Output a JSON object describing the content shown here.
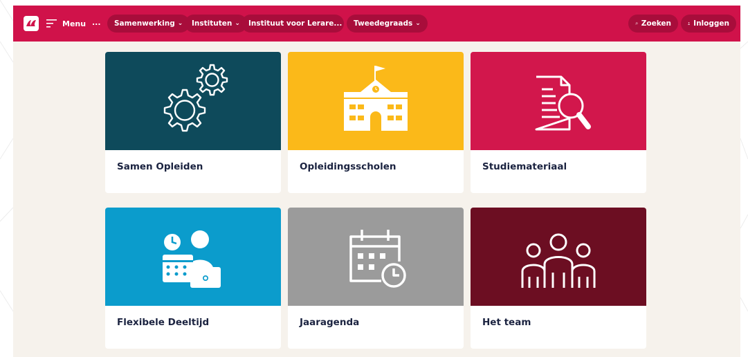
{
  "nav": {
    "menu_label": "Menu",
    "ellipsis": "...",
    "breadcrumbs": [
      {
        "label": "Samenwerking"
      },
      {
        "label": "Instituten"
      },
      {
        "label": "Instituut voor Lerare..."
      },
      {
        "label": "Tweedegraads"
      }
    ],
    "search_label": "Zoeken",
    "login_label": "Inloggen"
  },
  "tiles": [
    {
      "label": "Samen Opleiden",
      "icon": "gears-icon",
      "color": "#0e4a5b"
    },
    {
      "label": "Opleidingsscholen",
      "icon": "school-building-icon",
      "color": "#fbb919"
    },
    {
      "label": "Studiemateriaal",
      "icon": "document-search-icon",
      "color": "#d2174c"
    },
    {
      "label": "Flexibele Deeltijd",
      "icon": "person-laptop-calendar-icon",
      "color": "#0b9ccc"
    },
    {
      "label": "Jaaragenda",
      "icon": "calendar-clock-icon",
      "color": "#9b9b9b"
    },
    {
      "label": "Het team",
      "icon": "team-people-icon",
      "color": "#6c0e22"
    }
  ],
  "colors": {
    "brand": "#d0124a",
    "pill": "#a80d3b",
    "page_bg": "#f6f2ec",
    "label_text": "#1b2340"
  }
}
